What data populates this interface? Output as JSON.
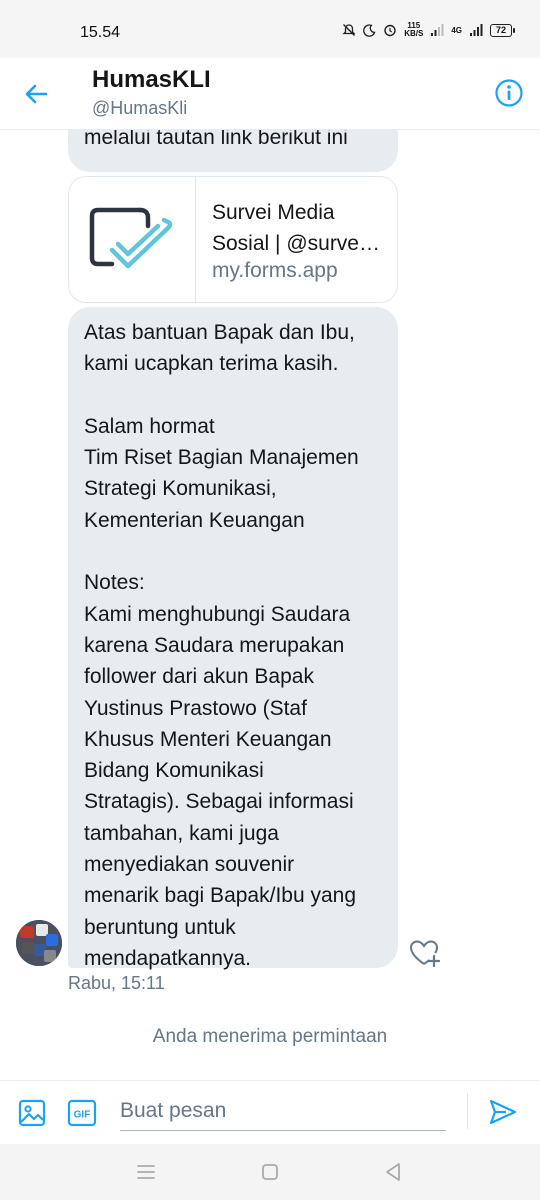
{
  "status_bar": {
    "time": "15.54",
    "net_speed_value": "115",
    "net_speed_unit": "KB/S",
    "network_type": "4G",
    "battery": "72"
  },
  "header": {
    "name": "HumasKLI",
    "handle": "@HumasKli"
  },
  "messages": {
    "top_fragment": "melalui tautan link berikut ini",
    "link_card": {
      "title_line1": "Survei Media",
      "title_line2": "Sosial | @surve…",
      "domain": "my.forms.app"
    },
    "main_lines": [
      "Atas bantuan Bapak dan Ibu,",
      "kami ucapkan terima kasih.",
      "",
      "Salam hormat",
      "Tim Riset Bagian Manajemen",
      "Strategi Komunikasi,",
      "Kementerian Keuangan",
      "",
      "Notes:",
      "Kami menghubungi Saudara",
      "karena Saudara merupakan",
      "follower dari akun Bapak",
      "Yustinus Prastowo (Staf",
      "Khusus Menteri Keuangan",
      "Bidang Komunikasi",
      "Stratagis). Sebagai informasi",
      "tambahan, kami juga",
      "menyediakan souvenir",
      "menarik bagi Bapak/Ibu yang",
      "beruntung untuk",
      "mendapatkannya."
    ],
    "timestamp": "Rabu, 15:11",
    "request_note": "Anda menerima permintaan"
  },
  "composer": {
    "placeholder": "Buat pesan",
    "gif_label": "GIF"
  },
  "colors": {
    "accent": "#1da1f2",
    "bubble": "#e6ecf0",
    "secondary_text": "#657786"
  },
  "icons": [
    "back-arrow-icon",
    "info-icon",
    "forms-logo-icon",
    "heart-add-icon",
    "image-icon",
    "gif-icon",
    "send-icon",
    "menu-icon",
    "home-icon",
    "back-triangle-icon"
  ]
}
